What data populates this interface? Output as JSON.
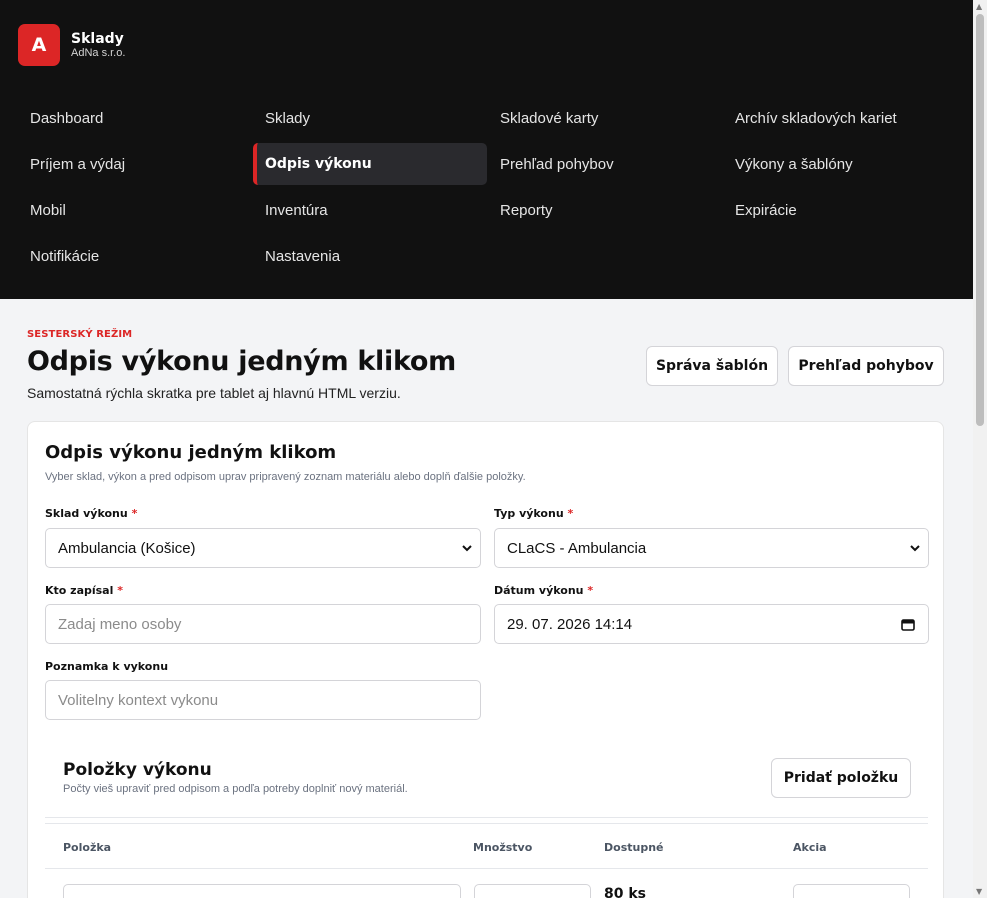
{
  "brand": {
    "logo_letter": "A",
    "title": "Sklady",
    "subtitle": "AdNa s.r.o.",
    "accent": "#dc2626"
  },
  "nav": [
    {
      "label": "Dashboard",
      "active": false
    },
    {
      "label": "Sklady",
      "active": false
    },
    {
      "label": "Skladové karty",
      "active": false
    },
    {
      "label": "Archív skladových kariet",
      "active": false
    },
    {
      "label": "Príjem a výdaj",
      "active": false
    },
    {
      "label": "Odpis výkonu",
      "active": true
    },
    {
      "label": "Prehľad pohybov",
      "active": false
    },
    {
      "label": "Výkony a šablóny",
      "active": false
    },
    {
      "label": "Mobil",
      "active": false
    },
    {
      "label": "Inventúra",
      "active": false
    },
    {
      "label": "Reporty",
      "active": false
    },
    {
      "label": "Expirácie",
      "active": false
    },
    {
      "label": "Notifikácie",
      "active": false
    },
    {
      "label": "Nastavenia",
      "active": false
    }
  ],
  "header": {
    "mode_label": "SESTERSKÝ REŽIM",
    "title": "Odpis výkonu jedným klikom",
    "subtitle": "Samostatná rýchla skratka pre tablet aj hlavnú HTML verziu.",
    "manage_templates_label": "Správa šablón",
    "movements_label": "Prehľad pohybov"
  },
  "form": {
    "title": "Odpis výkonu jedným klikom",
    "subtitle": "Vyber sklad, výkon a pred odpisom uprav pripravený zoznam materiálu alebo doplň ďalšie položky.",
    "warehouse": {
      "label": "Sklad výkonu",
      "required_mark": "*",
      "value": "Ambulancia (Košice)"
    },
    "type": {
      "label": "Typ výkonu",
      "required_mark": "*",
      "value": "CLaCS - Ambulancia"
    },
    "author": {
      "label": "Kto zapísal",
      "required_mark": "*",
      "placeholder": "Zadaj meno osoby"
    },
    "date": {
      "label": "Dátum výkonu",
      "required_mark": "*",
      "value": "29. 07. 2026 14:14"
    },
    "note": {
      "label": "Poznamka k vykonu",
      "placeholder": "Volitelny kontext vykonu"
    }
  },
  "items": {
    "title": "Položky výkonu",
    "subtitle": "Počty vieš upraviť pred odpisom a podľa potreby doplniť nový materiál.",
    "add_label": "Pridať položku",
    "columns": [
      "Položka",
      "Množstvo",
      "Dostupné",
      "Akcia"
    ],
    "rows": [
      {
        "available": "80 ks"
      }
    ]
  }
}
